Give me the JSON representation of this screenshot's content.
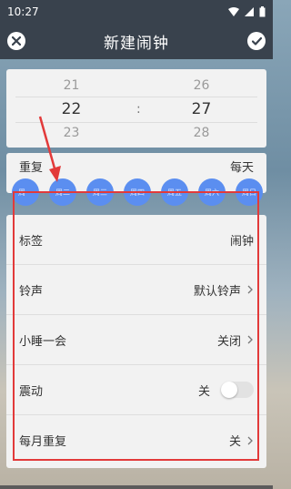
{
  "status": {
    "time": "10:27"
  },
  "appbar": {
    "title": "新建闹钟",
    "close_icon": "close-circle-icon",
    "confirm_icon": "check-circle-icon"
  },
  "picker": {
    "hours": [
      "21",
      "22",
      "23"
    ],
    "minutes": [
      "26",
      "27",
      "28"
    ],
    "separator": ":"
  },
  "repeat": {
    "label": "重复",
    "value": "每天"
  },
  "days": [
    "周一",
    "周二",
    "周三",
    "周四",
    "周五",
    "周六",
    "周日"
  ],
  "settings": {
    "label_row": {
      "label": "标签",
      "value": "闹钟"
    },
    "ringtone": {
      "label": "铃声",
      "value": "默认铃声"
    },
    "snooze": {
      "label": "小睡一会",
      "value": "关闭"
    },
    "vibrate": {
      "label": "震动",
      "value": "关",
      "on": false
    },
    "monthly": {
      "label": "每月重复",
      "value": "关"
    }
  },
  "colors": {
    "bar": "#39424d",
    "accent": "#5b8ef0",
    "highlight": "#e23a3a"
  }
}
